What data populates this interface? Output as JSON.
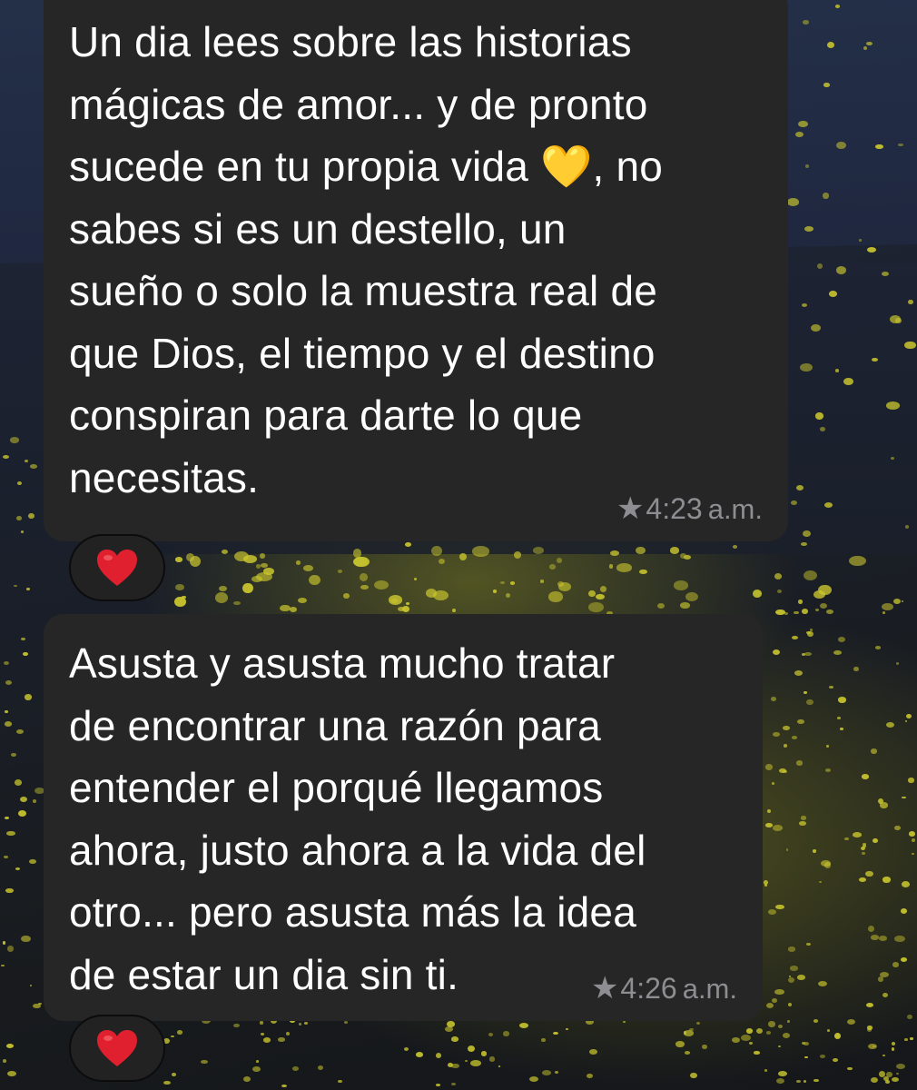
{
  "messages": [
    {
      "text": "Un dia lees sobre las historias\nmágicas de amor... y de pronto\nsucede en tu propia vida 💛, no\nsabes si es un destello, un\nsueño o solo la muestra real de\nque Dios, el tiempo y el destino\nconspiran para darte lo que\nnecesitas.",
      "time": "4:23",
      "ampm": "a.m.",
      "starred_icon": "star-icon",
      "reaction": "heart"
    },
    {
      "text": "Asusta y asusta mucho tratar\nde encontrar una razón para\nentender el porqué llegamos\nahora, justo ahora a la vida del\notro... pero asusta más la idea\nde estar un dia sin ti.",
      "time": "4:26",
      "ampm": "a.m.",
      "starred_icon": "star-icon",
      "reaction": "heart"
    }
  ],
  "colors": {
    "bubble": "#262626",
    "text": "#ffffff",
    "meta": "#8e8e92",
    "heart": "#e0202e",
    "wallpaper_dots": "#c9c52e"
  }
}
